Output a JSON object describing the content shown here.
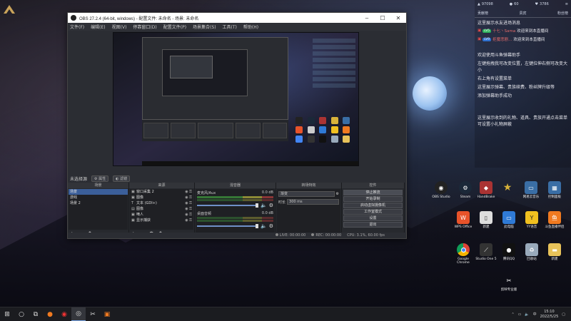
{
  "obs": {
    "title": "OBS 27.2.4 (64-bit, windows) - 配置文件: 未命名 - 场景: 未命名",
    "menu": [
      "文件(F)",
      "编辑(E)",
      "视图(V)",
      "停靠窗口(D)",
      "配置文件(P)",
      "场景集合(S)",
      "工具(T)",
      "帮助(H)"
    ],
    "source_label": "未选择源",
    "props_btn": "属性",
    "filters_btn": "滤镜",
    "docks": {
      "scenes_title": "场景",
      "sources_title": "来源",
      "mixer_title": "混音器",
      "transitions_title": "转场特效",
      "controls_title": "控件"
    },
    "scenes": [
      "场景",
      "游戏",
      "场景 2"
    ],
    "sources": [
      {
        "icon": "camera-icon",
        "name": "窗口采集 2"
      },
      {
        "icon": "camera-icon",
        "name": "图像"
      },
      {
        "icon": "text-icon",
        "name": "文本 (GDI+)"
      },
      {
        "icon": "image-icon",
        "name": "图像"
      },
      {
        "icon": "camera-icon",
        "name": "嘀人"
      },
      {
        "icon": "camera-icon",
        "name": "显示捕获"
      }
    ],
    "mixer": [
      {
        "name": "麦克风/Aux",
        "level": "0.0 dB"
      },
      {
        "name": "桌面音频",
        "level": "0.0 dB"
      }
    ],
    "transition": {
      "type": "渐变",
      "duration_label": "时长",
      "duration": "300 ms"
    },
    "controls": [
      "停止推流",
      "开始录制",
      "启动虚拟摄像机",
      "工作室模式",
      "设置",
      "退出"
    ],
    "status": {
      "live": "LIVE: 00:00:00",
      "rec": "REC: 00:00:00",
      "cpu": "CPU: 3.1%, 60.00 fps"
    }
  },
  "chat": {
    "stats": [
      "97098",
      "60",
      "3786"
    ],
    "tabs": [
      "贡献榜",
      "贵宾",
      "粉丝榜"
    ],
    "welcome": "这里展示水友进场消息",
    "messages": [
      {
        "badge": "LV5",
        "user": "十七丶Sama",
        "text": "欢迎来到本直播间"
      },
      {
        "badge": "LV9",
        "user": "拒魔悲剧...",
        "text": "欢迎来到本直播间"
      }
    ],
    "intro_lines": [
      "欢迎使用斗鱼弹幕助手",
      "左键拖拽我可改变位置，左键拉伸右侧可改变大小",
      "右上角有设置菜单",
      "这里展示弹幕、贵族续费、粉丝牌升级等",
      "添加弹幕助手成功"
    ],
    "gift_line": "这里展示收到的礼物、道具、贵族开通点击菜单可设置小礼物屏蔽"
  },
  "desktop_icons": [
    {
      "label": "OBS Studio",
      "icon": "obs-icon",
      "color": "#222222"
    },
    {
      "label": "Steam",
      "icon": "steam-icon",
      "color": "#1b2838"
    },
    {
      "label": "HandBrake",
      "icon": "handbrake-icon",
      "color": "#a33"
    },
    {
      "label": "",
      "icon": "star-icon",
      "color": "#d8b23a"
    },
    {
      "label": "网易云音乐",
      "icon": "computer-icon",
      "color": "#3a6ea5"
    },
    {
      "label": "控制面板",
      "icon": "control-panel-icon",
      "color": "#3a6ea5"
    },
    {
      "label": "WPS Office",
      "icon": "wps-icon",
      "color": "#e8532a"
    },
    {
      "label": "新建",
      "icon": "file-icon",
      "color": "#cccccc"
    },
    {
      "label": "此电脑",
      "icon": "pc-icon",
      "color": "#2f7ad6"
    },
    {
      "label": "YY语音",
      "icon": "yy-icon",
      "color": "#f0c020"
    },
    {
      "label": "斗鱼直播伴侣",
      "icon": "douyu-icon",
      "color": "#f07a20"
    },
    {
      "label": "Google Chrome",
      "icon": "chrome-icon",
      "color": "#4285f4"
    },
    {
      "label": "Studio One 5",
      "icon": "studio-icon",
      "color": "#333333"
    },
    {
      "label": "腾讯QQ",
      "icon": "qq-icon",
      "color": "#111111"
    },
    {
      "label": "回收站",
      "icon": "recycle-bin-icon",
      "color": "#9ab"
    },
    {
      "label": "新建",
      "icon": "folder-icon",
      "color": "#e8c35a"
    },
    {
      "label": "剪映专业版",
      "icon": "capcut-icon",
      "color": "#111111"
    }
  ],
  "taskbar": {
    "time": "15:10",
    "date": "2022/5/25",
    "lang": "中",
    "apps": [
      "start-icon",
      "search-icon",
      "task-view-icon",
      "firefox-icon",
      "netease-icon",
      "obs-icon",
      "capcut-icon",
      "douyu-icon"
    ]
  }
}
